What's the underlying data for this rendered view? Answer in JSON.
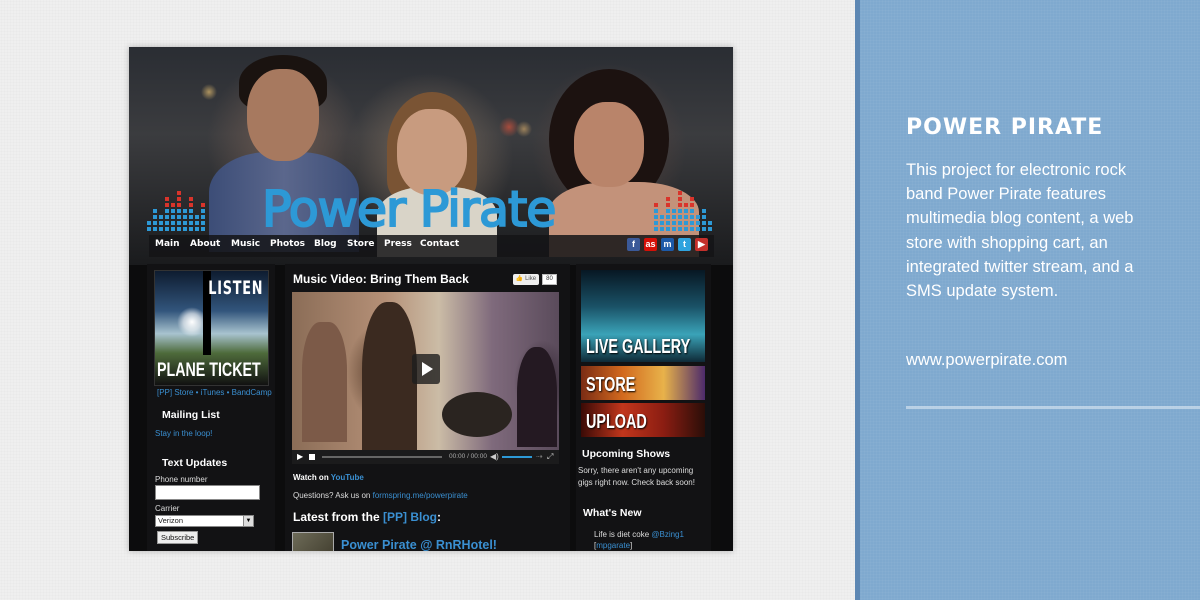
{
  "panel": {
    "title": "POWER PIRATE",
    "description": "This project for electronic rock band Power Pirate features multimedia blog content, a web store with shopping cart, an integrated twitter stream, and a SMS update system.",
    "link": "www.powerpirate.com"
  },
  "site": {
    "logo": "Power Pirate",
    "nav": [
      "Main",
      "About",
      "Music",
      "Photos",
      "Blog",
      "Store",
      "Press",
      "Contact"
    ],
    "social_icons": [
      "facebook-icon",
      "lastfm-icon",
      "myspace-icon",
      "twitter-icon",
      "youtube-icon"
    ],
    "left": {
      "ticket_top": "LISTEN",
      "ticket_bottom": "PLANE TICKET",
      "store_links": "[PP] Store • iTunes • BandCamp",
      "mailing_title": "Mailing List",
      "mailing_link": "Stay in the loop!",
      "text_title": "Text Updates",
      "phone_label": "Phone number",
      "carrier_label": "Carrier",
      "carrier_value": "Verizon",
      "subscribe": "Subscribe"
    },
    "middle": {
      "video_title": "Music Video: Bring Them Back",
      "like": "Like",
      "like_count": "80",
      "time": "00:00 / 00:00",
      "watch_prefix": "Watch on ",
      "watch_link": "YouTube",
      "questions_prefix": "Questions? Ask us on ",
      "questions_link": "formspring.me/powerpirate",
      "blog_heading_prefix": "Latest from the ",
      "blog_heading_link": "[PP] Blog",
      "blog_heading_suffix": ":",
      "blog_post_title": "Power Pirate @ RnRHotel!"
    },
    "right": {
      "tiles": [
        "LIVE GALLERY",
        "STORE",
        "UPLOAD"
      ],
      "upcoming_title": "Upcoming Shows",
      "upcoming_text": "Sorry, there aren't any upcoming gigs right now. Check back soon!",
      "whats_new_title": "What's New",
      "tweet_text": "Life is diet coke ",
      "tweet_user": "@Bzing1",
      "tweet_tag": "mpgarate"
    }
  },
  "colors": {
    "panel_bg": "#7fa9cf",
    "logo_blue": "#2d99d6",
    "link_blue": "#3a8fd1",
    "eq_red": "#d9342b",
    "eq_blue": "#2d99d6"
  }
}
